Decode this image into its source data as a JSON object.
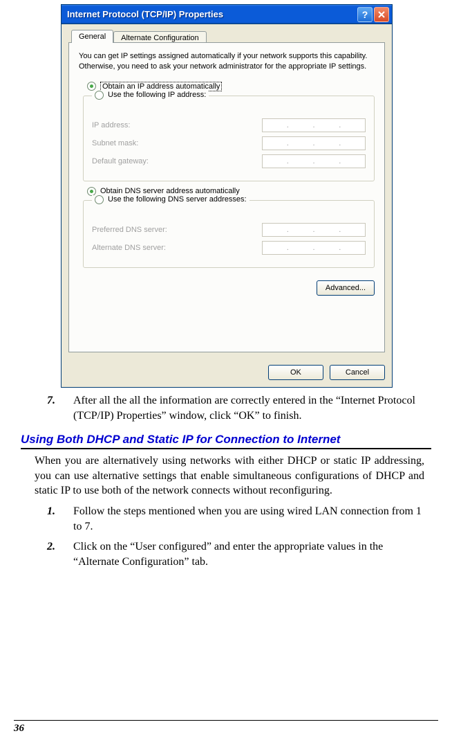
{
  "dialog": {
    "title": "Internet Protocol (TCP/IP) Properties",
    "tabs": {
      "general": "General",
      "alt": "Alternate Configuration"
    },
    "intro": "You can get IP settings assigned automatically if your network supports this capability. Otherwise, you need to ask your network administrator for the appropriate IP settings.",
    "radio": {
      "obtain_ip": "Obtain an IP address automatically",
      "use_ip": "Use the following IP address:",
      "obtain_dns": "Obtain DNS server address automatically",
      "use_dns": "Use the following DNS server addresses:"
    },
    "fields": {
      "ip": "IP address:",
      "subnet": "Subnet mask:",
      "gateway": "Default gateway:",
      "pref_dns": "Preferred DNS server:",
      "alt_dns": "Alternate DNS server:"
    },
    "buttons": {
      "advanced": "Advanced...",
      "ok": "OK",
      "cancel": "Cancel"
    }
  },
  "doc": {
    "step7_num": "7.",
    "step7": "After all the all the information are correctly entered in the “Internet Protocol (TCP/IP) Properties” window, click “OK” to finish.",
    "heading": "Using Both DHCP and Static IP for Connection to Internet",
    "para": "When you are alternatively using networks with either DHCP or static IP addressing, you can use alternative settings that enable simultaneous configurations of DHCP and static IP to use both of the network connects without reconfiguring.",
    "s1_num": "1.",
    "s1": "Follow the steps mentioned when you are using wired LAN connection from 1 to 7.",
    "s2_num": "2.",
    "s2": "Click on the “User configured” and enter the appropriate values in the “Alternate Configuration” tab.",
    "page_number": "36"
  }
}
